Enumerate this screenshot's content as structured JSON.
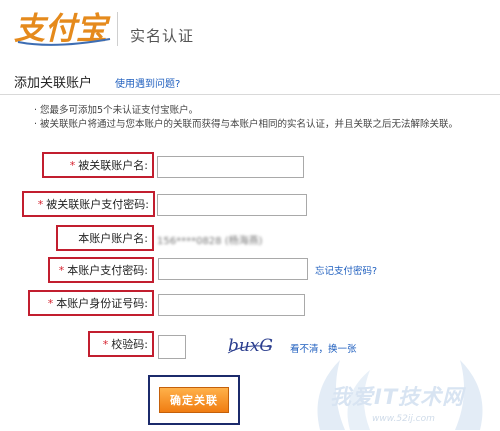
{
  "header": {
    "logo_text": "支付宝",
    "title": "实名认证"
  },
  "section": {
    "title": "添加关联账户",
    "help_link": "使用遇到问题?"
  },
  "notes": [
    "您最多可添加5个未认证支付宝账户。",
    "被关联账户将通过与您本账户的关联而获得与本账户相同的实名认证，并且关联之后无法解除关联。"
  ],
  "form": {
    "required_mark": "*",
    "linked_account": {
      "label": "被关联账户名:",
      "value": ""
    },
    "linked_password": {
      "label": "被关联账户支付密码:",
      "value": ""
    },
    "this_account": {
      "label": "本账户账户名:",
      "value": "156****0828 (杨海燕)"
    },
    "this_password": {
      "label": "本账户支付密码:",
      "value": "",
      "forgot_link": "忘记支付密码?"
    },
    "id_number": {
      "label": "本账户身份证号码:",
      "value": ""
    },
    "captcha": {
      "label": "校验码:",
      "value": "",
      "image_text": "buxG",
      "refresh_link": "看不清，换一张"
    },
    "submit_label": "确定关联"
  },
  "watermark": {
    "text": "我爱IT技术网",
    "url": "www.52ij.com"
  },
  "colors": {
    "highlight_red": "#c21e2f",
    "highlight_navy": "#1b2a6b",
    "link_blue": "#1f5fbf",
    "button_orange": "#f07d12"
  }
}
